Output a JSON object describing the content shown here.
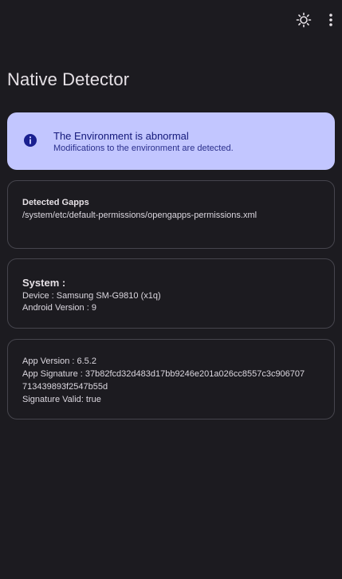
{
  "toolbar": {
    "theme_icon": "brightness-icon",
    "more_icon": "more-vert-icon"
  },
  "app": {
    "title": "Native Detector"
  },
  "alert": {
    "title": "The Environment is abnormal",
    "subtitle": "Modifications to the environment are detected.",
    "icon": "info-icon",
    "background": "#c2c6ff"
  },
  "gapps": {
    "heading": "Detected Gapps",
    "path": "/system/etc/default-permissions/opengapps-permissions.xml"
  },
  "system": {
    "heading": "System :",
    "device": "Device : Samsung SM-G9810  (x1q)",
    "android_version": "Android Version : 9"
  },
  "app_info": {
    "version": "App Version : 6.5.2",
    "signature_line1": "App Signature : 37b82fcd32d483d17bb9246e201a026cc8557c3c906707",
    "signature_line2": "713439893f2547b55d",
    "signature_valid": "Signature Valid: true"
  }
}
